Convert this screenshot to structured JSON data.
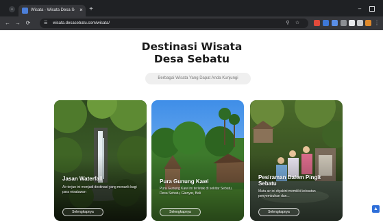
{
  "browser": {
    "tab_title": "Wisata - Wisata Desa Sebatu",
    "tab_close": "×",
    "new_tab": "+",
    "url": "wisata.desasebatu.com/wisata/",
    "back": "←",
    "forward": "→",
    "reload": "⟳",
    "site_info": "☰",
    "zoom": "⚲",
    "bookmark": "☆",
    "minimize": "–",
    "menu": "⋮",
    "tab_search": "⌄",
    "extensions": [
      {
        "name": "ext-red-icon",
        "color": "#e24a3b"
      },
      {
        "name": "ext-blue-icon",
        "color": "#3d78d8"
      },
      {
        "name": "ext-blue2-icon",
        "color": "#5a8ee6"
      },
      {
        "name": "ext-gray-icon",
        "color": "#8c8f94"
      },
      {
        "name": "ext-white-icon",
        "color": "#e8eaed"
      },
      {
        "name": "ext-puzzle-icon",
        "color": "#c9cbce"
      },
      {
        "name": "ext-orange-icon",
        "color": "#e08a2c"
      }
    ]
  },
  "page": {
    "title_line1": "Destinasi Wisata",
    "title_line2": "Desa Sebatu",
    "subtitle": "Berbagai Wisata Yang Dapat Anda Kunjungi",
    "scroll_top": "▲"
  },
  "cards": [
    {
      "title": "Jasan Waterfall",
      "description": "Air terjun ini menjadi destinasi yang menarik bagi para wisatawan",
      "button": "Selengkapnya"
    },
    {
      "title": "Pura Gunung Kawi",
      "description": "Pura Gunung Kawi ini terletak di sekitar Sebatu, Desa Sebatu, Gianyar, Bali",
      "button": "Selengkapnya"
    },
    {
      "title": "Pesiraman Dalem Pingit Sebatu",
      "description": "Mata air ini diyakini memiliki kekuatan penyembuhan dan...",
      "button": "Selengkapnya"
    }
  ]
}
